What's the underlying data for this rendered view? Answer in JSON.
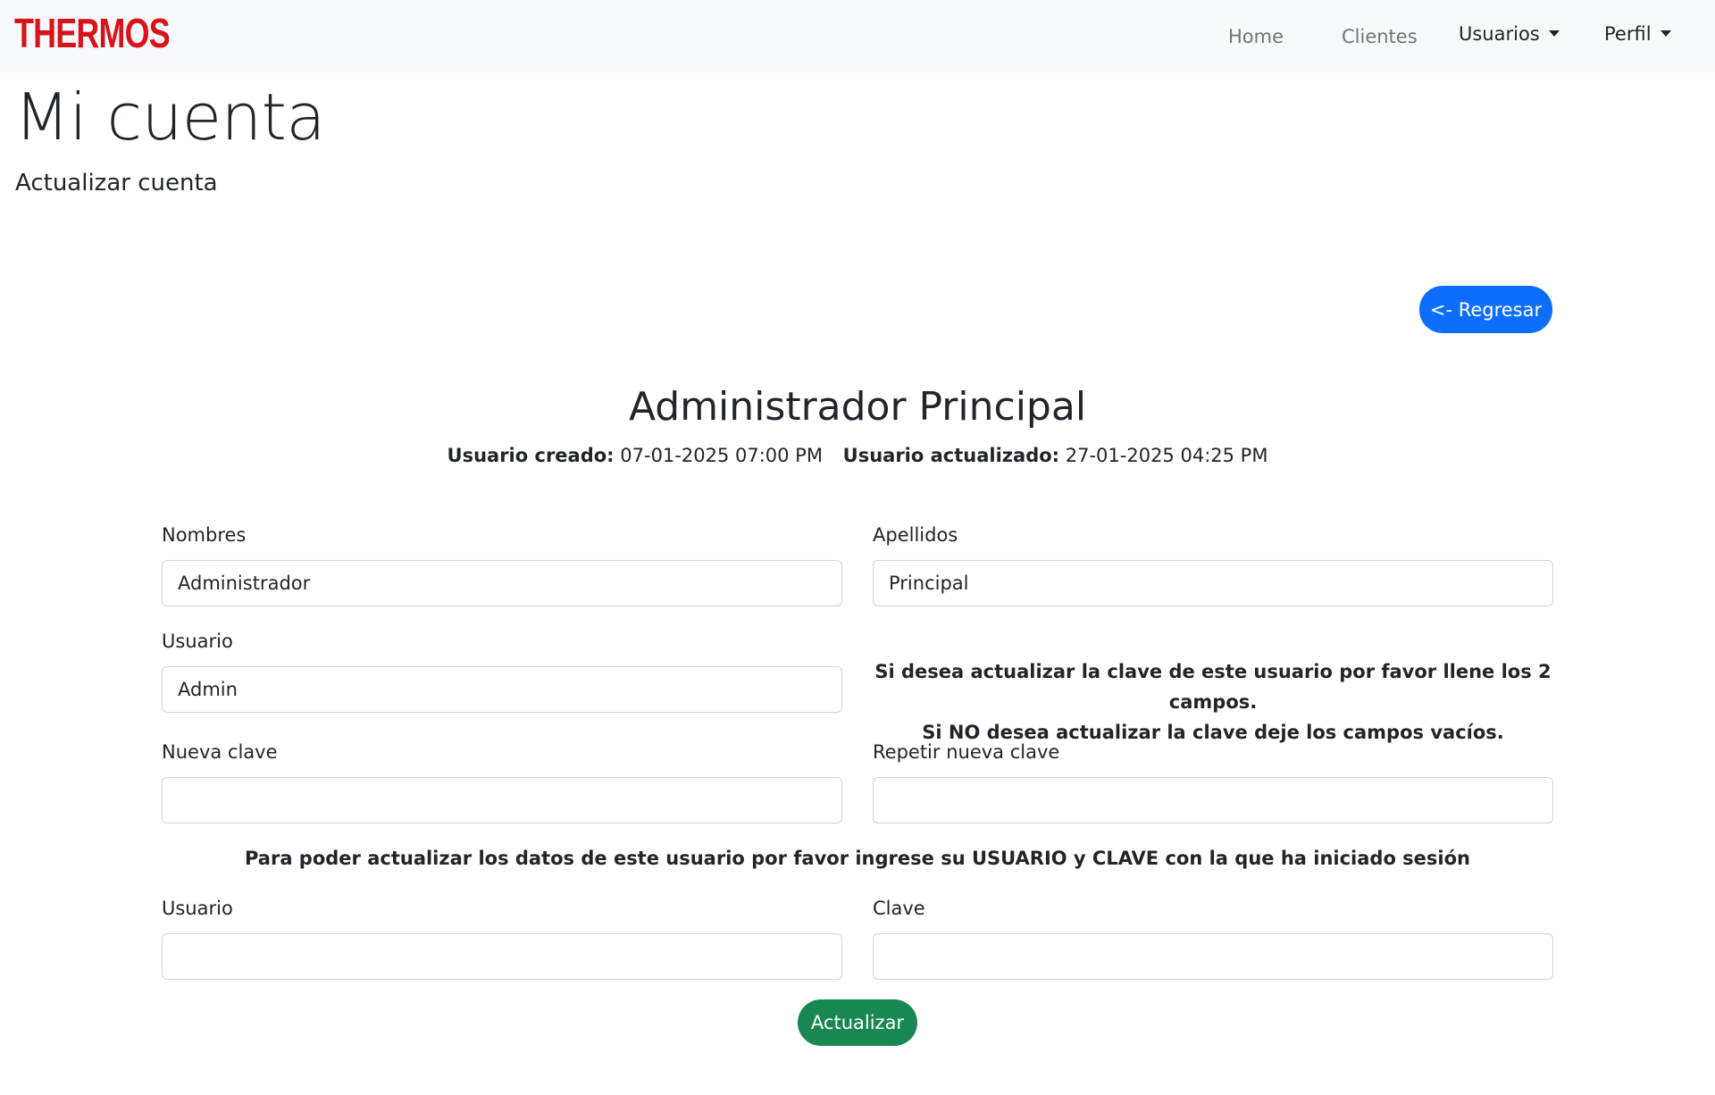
{
  "navbar": {
    "brand": "THERMOS",
    "links": [
      "Home",
      "Clientes"
    ],
    "dropdowns": [
      "Usuarios",
      "Perfil"
    ]
  },
  "header": {
    "title": "Mi cuenta",
    "subtitle": "Actualizar cuenta"
  },
  "actions": {
    "back_label": "<- Regresar",
    "update_label": "Actualizar"
  },
  "user": {
    "full_name": "Administrador Principal",
    "created_label": "Usuario creado:",
    "created_value": "07-01-2025 07:00 PM",
    "updated_label": "Usuario actualizado:",
    "updated_value": "27-01-2025 04:25 PM"
  },
  "form": {
    "nombres_label": "Nombres",
    "nombres_value": "Administrador",
    "apellidos_label": "Apellidos",
    "apellidos_value": "Principal",
    "usuario_label": "Usuario",
    "usuario_value": "Admin",
    "password_note_line1": "Si desea actualizar la clave de este usuario por favor llene los 2 campos.",
    "password_note_line2": "Si NO desea actualizar la clave deje los campos vacíos.",
    "nueva_clave_label": "Nueva clave",
    "nueva_clave_value": "",
    "repetir_clave_label": "Repetir nueva clave",
    "repetir_clave_value": "",
    "auth_note": "Para poder actualizar los datos de este usuario por favor ingrese su USUARIO y CLAVE con la que ha iniciado sesión",
    "auth_usuario_label": "Usuario",
    "auth_usuario_value": "",
    "auth_clave_label": "Clave",
    "auth_clave_value": ""
  },
  "colors": {
    "brand": "#d7141a",
    "primary": "#0d6efd",
    "success": "#198754",
    "navbar_bg": "#f8f9fa"
  }
}
